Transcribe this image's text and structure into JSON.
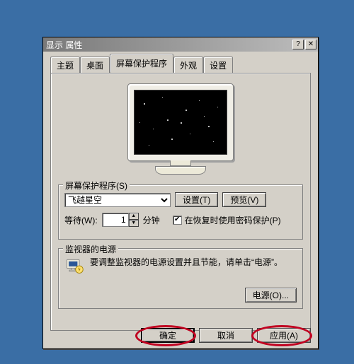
{
  "window": {
    "title": "显示 属性"
  },
  "tabs": {
    "theme": "主题",
    "desktop": "桌面",
    "screensaver": "屏幕保护程序",
    "appearance": "外观",
    "settings": "设置"
  },
  "screensaver_group": {
    "title": "屏幕保护程序(S)",
    "selected": "飞越星空",
    "settings_btn": "设置(T)",
    "preview_btn": "预览(V)",
    "wait_label": "等待(W):",
    "wait_value": "1",
    "wait_unit": "分钟",
    "password_checkbox": "在恢复时使用密码保护(P)",
    "password_checked": true
  },
  "power_group": {
    "title": "监视器的电源",
    "desc": "要调整监视器的电源设置并且节能，请单击“电源”。",
    "power_btn": "电源(O)..."
  },
  "buttons": {
    "ok": "确定",
    "cancel": "取消",
    "apply": "应用(A)"
  }
}
